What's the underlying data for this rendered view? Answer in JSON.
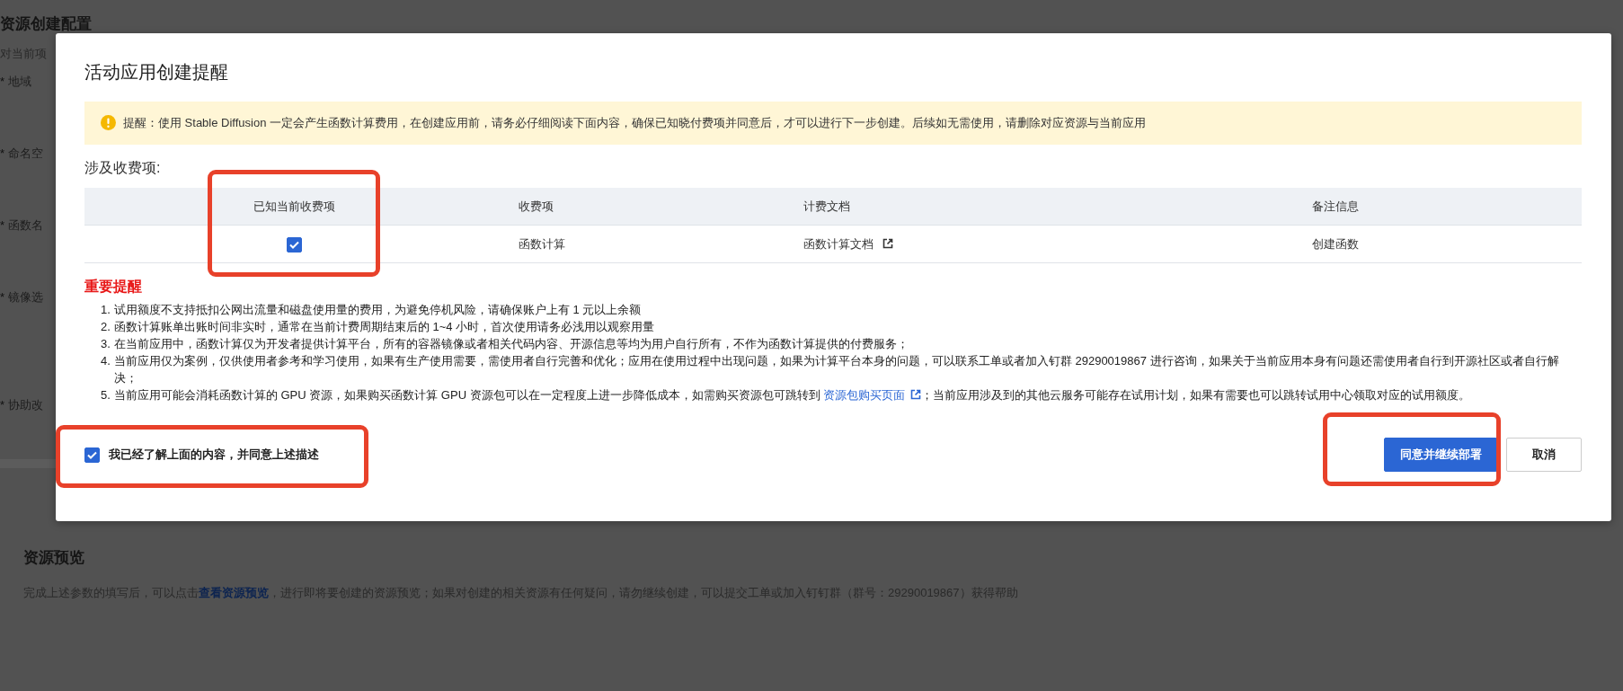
{
  "background": {
    "section_title": "资源创建配置",
    "section_note": "对当前项",
    "fields": [
      {
        "mark": "*",
        "label": "地域"
      },
      {
        "mark": "*",
        "label": "命名空"
      },
      {
        "mark": "*",
        "label": "函数名"
      },
      {
        "mark": "*",
        "label": "镜像选"
      },
      {
        "mark": "*",
        "label": "协助改"
      }
    ],
    "preview": {
      "title": "资源预览",
      "text_before": "完成上述参数的填写后，可以点击",
      "link": "查看资源预览",
      "text_after": "，进行即将要创建的资源预览；如果对创建的相关资源有任何疑问，请勿继续创建，可以提交工单或加入钉钉群（群号：29290019867）获得帮助"
    }
  },
  "dialog": {
    "title": "活动应用创建提醒",
    "alert": "提醒：使用 Stable Diffusion 一定会产生函数计算费用，在创建应用前，请务必仔细阅读下面内容，确保已知晓付费项并同意后，才可以进行下一步创建。后续如无需使用，请删除对应资源与当前应用",
    "charges_title": "涉及收费项:",
    "table": {
      "columns": [
        {
          "label": "已知当前收费项",
          "highlighted": true
        },
        {
          "label": "收费项",
          "highlighted": false
        },
        {
          "label": "计费文档",
          "highlighted": false
        },
        {
          "label": "备注信息",
          "highlighted": false
        }
      ],
      "rows": [
        {
          "checked": true,
          "item": "函数计算",
          "doc_link": "函数计算文档",
          "note": "创建函数"
        }
      ]
    },
    "important_title": "重要提醒",
    "notes": [
      {
        "number": "1.",
        "text": "试用额度不支持抵扣公网出流量和磁盘使用量的费用，为避免停机风险，请确保账户上有 1 元以上余额"
      },
      {
        "number": "2.",
        "text": "函数计算账单出账时间非实时，通常在当前计费周期结束后的 1~4 小时，首次使用请务必浅用以观察用量"
      },
      {
        "number": "3.",
        "text": "在当前应用中，函数计算仅为开发者提供计算平台，所有的容器镜像或者相关代码内容、开源信息等均为用户自行所有，不作为函数计算提供的付费服务；"
      },
      {
        "number": "4.",
        "text": "当前应用仅为案例，仅供使用者参考和学习使用，如果有生产使用需要，需使用者自行完善和优化；应用在使用过程中出现问题，如果为计算平台本身的问题，可以联系工单或者加入钉群 29290019867 进行咨询，如果关于当前应用本身有问题还需使用者自行到开源社区或者自行解决；"
      },
      {
        "number": "5.",
        "text": "当前应用可能会消耗函数计算的 GPU 资源，如果购买函数计算 GPU 资源包可以在一定程度上进一步降低成本，如需购买资源包可跳转到 ",
        "link": "资源包购买页面",
        "text_after": "；当前应用涉及到的其他云服务可能存在试用计划，如果有需要也可以跳转试用中心领取对应的试用额度。"
      }
    ],
    "agreement": {
      "label": "我已经了解上面的内容，并同意上述描述",
      "checked": true,
      "highlighted": true
    },
    "buttons": [
      {
        "label": "同意并继续部署",
        "kind": "primary",
        "highlighted": true
      },
      {
        "label": "取消",
        "kind": "secondary",
        "highlighted": false
      }
    ]
  }
}
